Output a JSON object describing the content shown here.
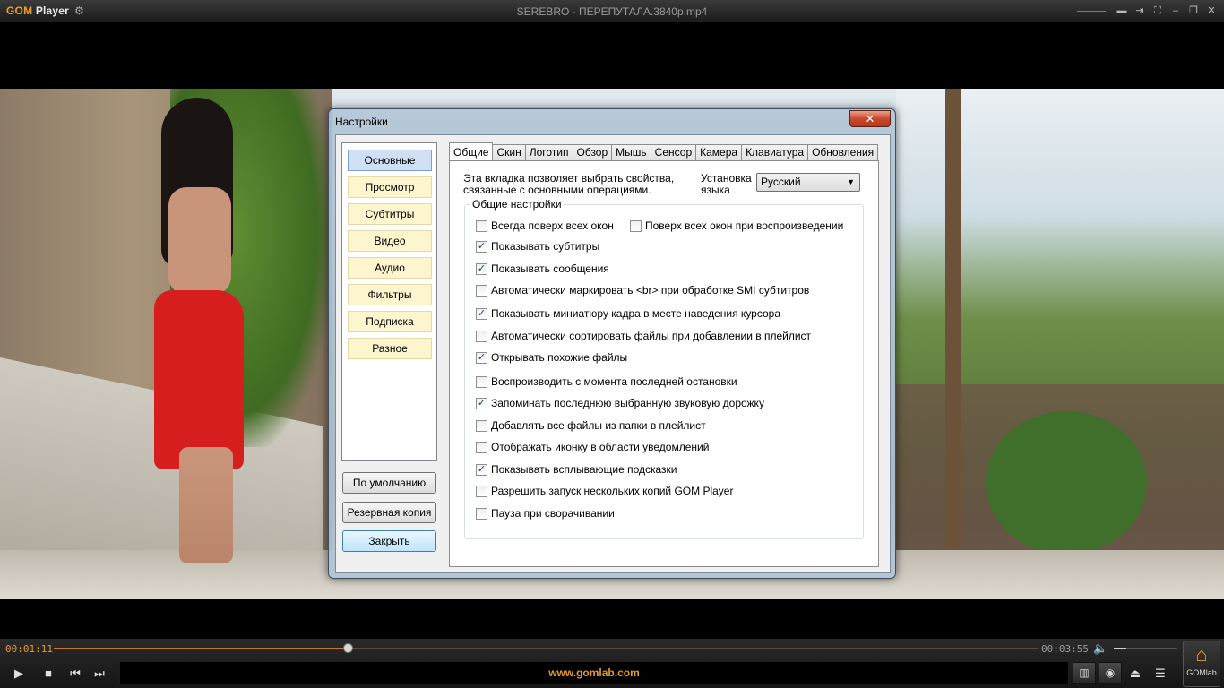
{
  "titlebar": {
    "logo_gom": "GOM",
    "logo_player": "Player",
    "title": "SEREBRO - ПЕРЕПУТАЛА.3840p.mp4"
  },
  "dialog": {
    "title": "Настройки",
    "close": "✕",
    "nav": [
      {
        "label": "Основные",
        "active": true
      },
      {
        "label": "Просмотр"
      },
      {
        "label": "Субтитры"
      },
      {
        "label": "Видео"
      },
      {
        "label": "Аудио"
      },
      {
        "label": "Фильтры"
      },
      {
        "label": "Подписка"
      },
      {
        "label": "Разное"
      }
    ],
    "buttons": {
      "defaults": "По умолчанию",
      "backup": "Резервная копия",
      "close": "Закрыть"
    },
    "tabs": [
      "Общие",
      "Скин",
      "Логотип",
      "Обзор",
      "Мышь",
      "Сенсор",
      "Камера",
      "Клавиатура",
      "Обновления"
    ],
    "general": {
      "description": "Эта вкладка позволяет выбрать свойства, связанные с основными операциями.",
      "language_label": "Установка языка",
      "language_value": "Русский",
      "group_title": "Общие настройки",
      "options": [
        {
          "label": "Всегда поверх всех окон",
          "checked": false
        },
        {
          "label": "Поверх всех окон при воспроизведении",
          "checked": false
        },
        {
          "label": "Показывать субтитры",
          "checked": true
        },
        {
          "label": "Показывать сообщения",
          "checked": true
        },
        {
          "label": "Автоматически маркировать <br> при обработке SMI субтитров",
          "checked": false
        },
        {
          "label": "Показывать миниатюру кадра в месте наведения курсора",
          "checked": true
        },
        {
          "label": "Автоматически сортировать файлы при добавлении в плейлист",
          "checked": false
        },
        {
          "label": "Открывать похожие файлы",
          "checked": true
        },
        {
          "label": "Воспроизводить с момента последней остановки",
          "checked": false
        },
        {
          "label": "Запоминать последнюю выбранную звуковую дорожку",
          "checked": true
        },
        {
          "label": "Добавлять все файлы из папки в плейлист",
          "checked": false
        },
        {
          "label": "Отображать иконку в области уведомлений",
          "checked": false
        },
        {
          "label": "Показывать всплывающие подсказки",
          "checked": true
        },
        {
          "label": "Разрешить запуск нескольких копий GOM Player",
          "checked": false
        },
        {
          "label": "Пауза при сворачивании",
          "checked": false
        }
      ]
    }
  },
  "player": {
    "current_time": "00:01:11",
    "total_time": "00:03:55",
    "progress_fraction": 0.3,
    "volume_fraction": 0.2,
    "info_text": "www.gomlab.com",
    "gomlab_label": "GOMlab"
  },
  "colors": {
    "accent": "#e39a2a",
    "close_button": "#c9482c",
    "nav_active": "#cfe0f4",
    "nav_item": "#fdf5cd"
  }
}
